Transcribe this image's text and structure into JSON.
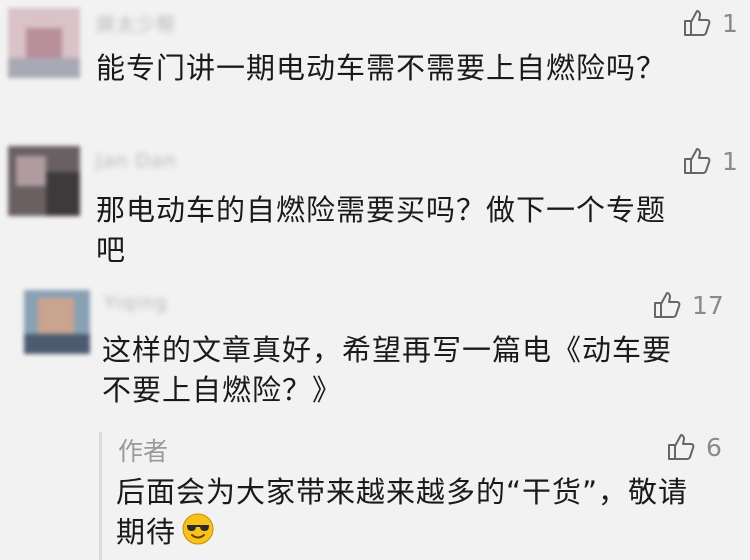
{
  "comments": [
    {
      "user": "屏太少帮",
      "likes": "1",
      "text_lines": [
        "能专门讲一期电动车需不需要上自燃险吗？"
      ]
    },
    {
      "user": "Jan Dan",
      "likes": "1",
      "text_lines": [
        "那电动车的自燃险需要买吗？做下一个专题",
        "吧"
      ]
    },
    {
      "user": "Yiqing",
      "likes": "17",
      "text_lines": [
        "这样的文章真好，希望再写一篇电《动车要",
        "不要上自燃险？》"
      ]
    }
  ],
  "author_reply": {
    "label": "作者",
    "likes": "6",
    "text_lines": [
      "后面会为大家带来越来越多的“干货”，敬请",
      "期待"
    ],
    "emoji": "sunglasses-smile-emoji"
  },
  "icons": {
    "like": "thumbs-up-icon"
  },
  "colors": {
    "background": "#f2f2f2",
    "text": "#1a1a1a",
    "muted": "#8a8a8a",
    "emoji_yellow": "#f7c21a"
  }
}
